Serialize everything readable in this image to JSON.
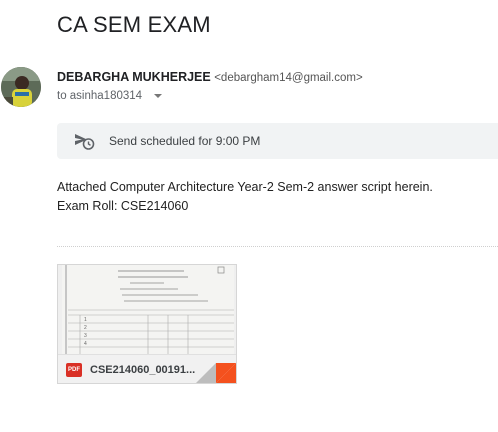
{
  "subject": "CA SEM EXAM",
  "sender": {
    "name": "DEBARGHA MUKHERJEE",
    "email": "<debargham14@gmail.com>"
  },
  "recipient": {
    "label": "to asinha180314"
  },
  "schedule": {
    "text": "Send scheduled for 9:00 PM",
    "icon": "scheduled-send-icon"
  },
  "body": {
    "line1": "Attached Computer Architecture Year-2 Sem-2 answer script herein.",
    "line2": "Exam Roll: CSE214060"
  },
  "attachment": {
    "filename": "CSE214060_00191...",
    "type_badge": "PDF",
    "preview_lines": [
      "EXAM ROLL NUMBER: CSE214060",
      "EXAM SPEC NUMBER: 0021000000",
      "SUBJECT NAME: Computer Architecture"
    ]
  }
}
